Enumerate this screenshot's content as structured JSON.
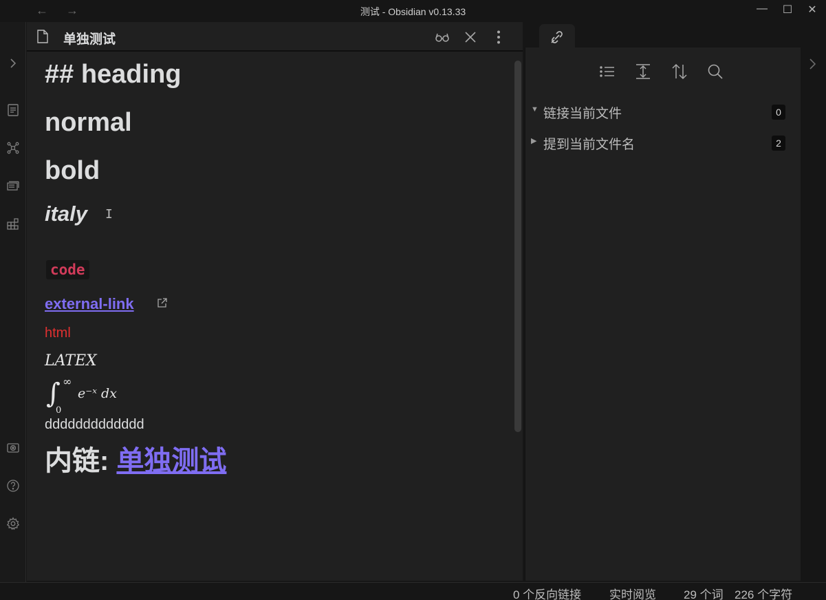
{
  "window": {
    "title": "测试 - Obsidian v0.13.33",
    "back_glyph": "←",
    "forward_glyph": "→",
    "minimize_glyph": "—",
    "maximize_glyph": "☐",
    "close_glyph": "✕"
  },
  "ribbon": {
    "expand_glyph": "›",
    "icons": [
      "chevron-right-icon",
      "file-switcher-icon",
      "graph-view-icon",
      "slides-icon",
      "templates-icon",
      "vault-icon",
      "help-icon",
      "settings-icon"
    ]
  },
  "editor": {
    "view_title": "单独测试",
    "actions": [
      "reading-mode-icon",
      "close-icon",
      "more-options-icon"
    ],
    "lines": {
      "heading": "## heading",
      "normal": "normal",
      "bold": "bold",
      "italic": "italy",
      "cursor": "I",
      "code": "code",
      "external_link": "external-link",
      "html": "html",
      "latex": "LATEX",
      "math_integrand": "e⁻ˣ dx",
      "math_upper": "∞",
      "math_lower": "0",
      "text": "ddddddddddddd",
      "internal_link_prefix": "内链: ",
      "internal_link": "单独测试"
    }
  },
  "backlinks": {
    "tab_icon": "backlinks-icon",
    "toolbar": [
      "collapse-results-icon",
      "expand-context-icon",
      "sort-icon",
      "search-icon"
    ],
    "sections": [
      {
        "label": "链接当前文件",
        "count": "0",
        "expanded": true,
        "tri": "▼"
      },
      {
        "label": "提到当前文件名",
        "count": "2",
        "expanded": false,
        "tri": "▶"
      }
    ]
  },
  "statusbar": {
    "backlinks": "0 个反向链接",
    "mode": "实时阅览",
    "words": "29 个词",
    "chars": "226 个字符"
  },
  "colors": {
    "accent": "#7f6df2",
    "code": "#d13b5a",
    "html": "#e03030",
    "background": "#202020"
  }
}
